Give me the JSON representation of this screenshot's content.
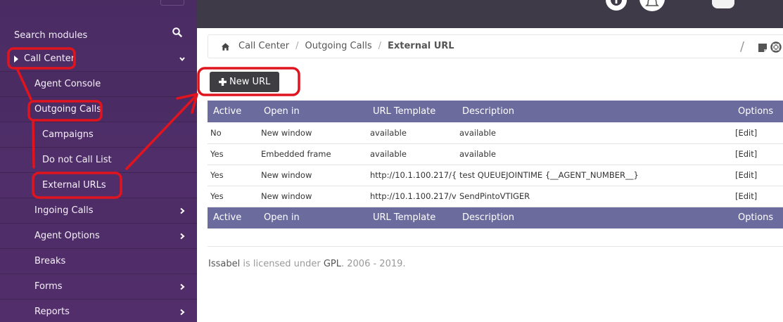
{
  "sidebar": {
    "search_label": "Search modules",
    "items": [
      {
        "label": "Call Center",
        "level": "top",
        "expanded": true
      },
      {
        "label": "Agent Console",
        "level": "sub"
      },
      {
        "label": "Outgoing Calls",
        "level": "sub",
        "expanded": true
      },
      {
        "label": "Campaigns",
        "level": "sub2"
      },
      {
        "label": "Do not Call List",
        "level": "sub2"
      },
      {
        "label": "External URLs",
        "level": "sub2",
        "active": true
      },
      {
        "label": "Ingoing Calls",
        "level": "sub"
      },
      {
        "label": "Agent Options",
        "level": "sub"
      },
      {
        "label": "Breaks",
        "level": "sub"
      },
      {
        "label": "Forms",
        "level": "sub"
      },
      {
        "label": "Reports",
        "level": "sub"
      }
    ]
  },
  "breadcrumb": {
    "items": [
      "Call Center",
      "Outgoing Calls",
      "External URL"
    ],
    "separator": "/"
  },
  "toolbar": {
    "new_label": "New URL"
  },
  "table": {
    "columns": [
      "Active",
      "Open in",
      "URL Template",
      "Description",
      "Options"
    ],
    "rows": [
      {
        "active": "No",
        "open_in": "New window",
        "url": "available",
        "description": "available",
        "options": "[Edit]"
      },
      {
        "active": "Yes",
        "open_in": "Embedded frame",
        "url": "available",
        "description": "available",
        "options": "[Edit]"
      },
      {
        "active": "Yes",
        "open_in": "New window",
        "url": "http://10.1.100.217/{",
        "description": "test QUEUEJOINTIME {__AGENT_NUMBER__}",
        "options": "[Edit]"
      },
      {
        "active": "Yes",
        "open_in": "New window",
        "url": "http://10.1.100.217/v",
        "description": "SendPintoVTIGER",
        "options": "[Edit]"
      }
    ]
  },
  "footer": {
    "brand": "Issabel",
    "text1": " is licensed under ",
    "license": "GPL",
    "text2": ". 2006 - 2019."
  },
  "colors": {
    "sidebar_bg": "#4a2c63",
    "topbar_bg": "#3e3a48",
    "table_header_bg": "#6b6b9e",
    "button_bg": "#3e3e42",
    "annotation_red": "#e0141e"
  },
  "icons": {
    "search": "search-icon",
    "home": "home-icon",
    "plus": "plus-icon",
    "chevron": "chevron-right-icon",
    "chevron_down": "chevron-down-icon",
    "caret": "caret-right-icon"
  }
}
